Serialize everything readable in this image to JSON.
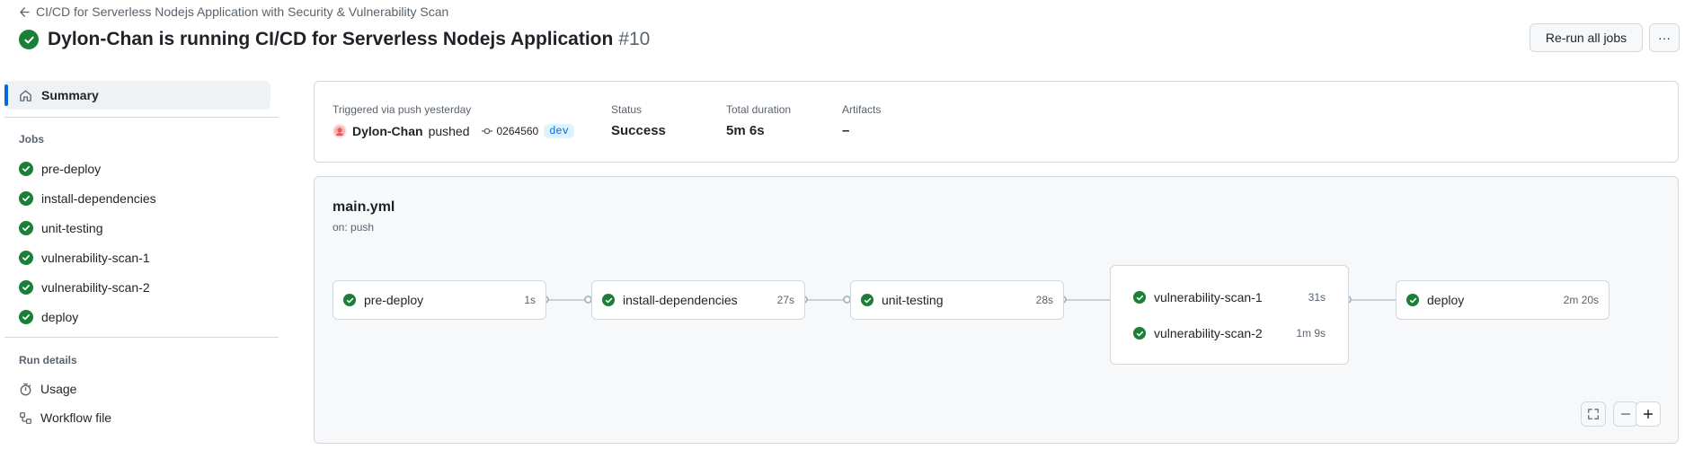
{
  "header": {
    "back_label": "CI/CD for Serverless Nodejs Application with Security & Vulnerability Scan",
    "title": "Dylon-Chan is running CI/CD for Serverless Nodejs Application",
    "run_number": "#10",
    "rerun_label": "Re-run all jobs",
    "more_label": "···"
  },
  "sidebar": {
    "summary_label": "Summary",
    "jobs_heading": "Jobs",
    "jobs": [
      "pre-deploy",
      "install-dependencies",
      "unit-testing",
      "vulnerability-scan-1",
      "vulnerability-scan-2",
      "deploy"
    ],
    "run_details_heading": "Run details",
    "details": [
      "Usage",
      "Workflow file"
    ]
  },
  "summary": {
    "trigger_label": "Triggered via push yesterday",
    "actor": "Dylon-Chan",
    "action": "pushed",
    "commit": "0264560",
    "branch": "dev",
    "status_label": "Status",
    "status_value": "Success",
    "duration_label": "Total duration",
    "duration_value": "5m 6s",
    "artifacts_label": "Artifacts",
    "artifacts_value": "–"
  },
  "workflow": {
    "name": "main.yml",
    "trigger": "on: push",
    "nodes": [
      {
        "name": "pre-deploy",
        "duration": "1s"
      },
      {
        "name": "install-dependencies",
        "duration": "27s"
      },
      {
        "name": "unit-testing",
        "duration": "28s"
      },
      {
        "name": "vulnerability-scan-1",
        "duration": "31s"
      },
      {
        "name": "vulnerability-scan-2",
        "duration": "1m 9s"
      },
      {
        "name": "deploy",
        "duration": "2m 20s"
      }
    ]
  },
  "colors": {
    "success": "#1a7f37",
    "accent": "#0969da"
  }
}
